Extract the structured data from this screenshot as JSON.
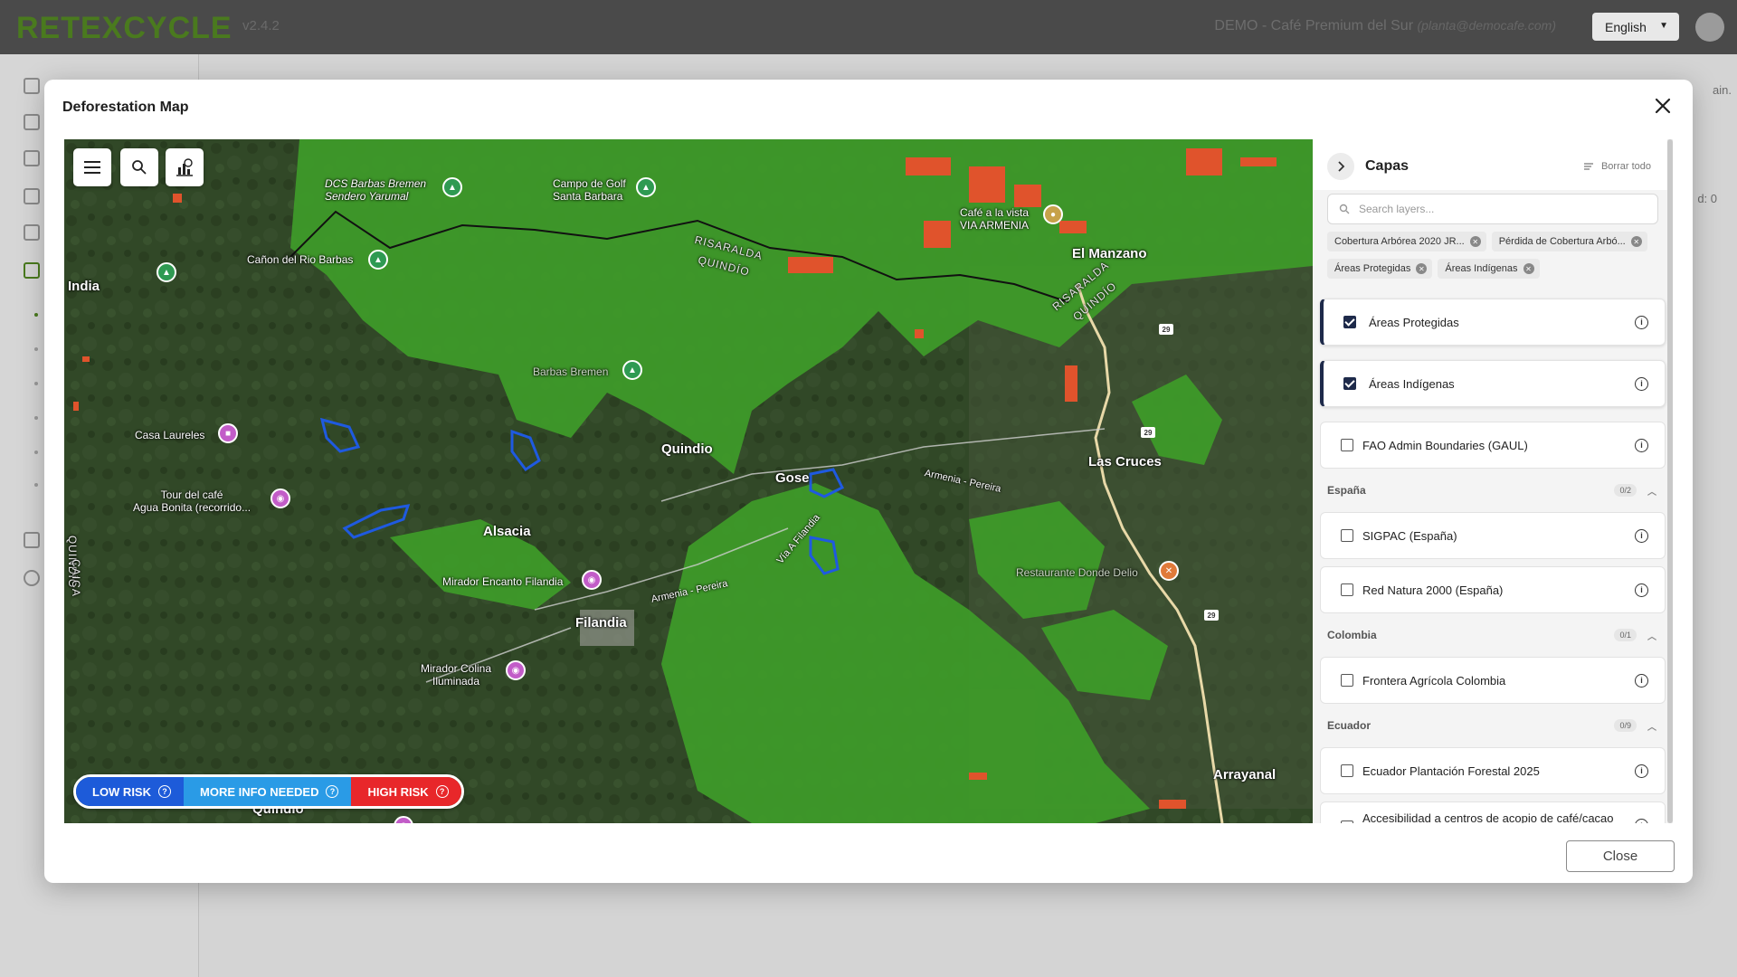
{
  "app": {
    "brand": "RETEXCYCLE",
    "version": "v2.4.2",
    "company": "DEMO - Café Premium del Sur",
    "company_email": "(planta@democafe.com)",
    "language": "English",
    "bg_text_right": "ain.",
    "bg_text_count": "d: 0"
  },
  "modal": {
    "title": "Deforestation Map",
    "close_label": "Close"
  },
  "map": {
    "tool_icons": [
      "menu-icon",
      "search-icon",
      "chart-icon"
    ],
    "place_labels": {
      "india": "India",
      "quindio_center": "Quindio",
      "alsacia": "Alsacia",
      "filandia": "Filandia",
      "gose": "Gose",
      "las_cruces": "Las Cruces",
      "el_manzano": "El Manzano",
      "arrayanal": "Arrayanal",
      "quindio_bottom": "Quindio"
    },
    "poi_labels": {
      "dcs_barbas": "DCS Barbas Bremen\nSendero Yarumal",
      "campo_golf": "Campo de Golf\nSanta Barbara",
      "canon_rio": "Cañon del Rio Barbas",
      "cafe_vista": "Café a la vista\nVIA ARMENIA",
      "barbas_bremen": "Barbas Bremen",
      "casa_laureles": "Casa Laureles",
      "tour_cafe": "Tour del café\nAgua Bonita (recorrido...",
      "mirador_encanto": "Mirador Encanto Filandia",
      "mirador_colina": "Mirador Colina\nIluminada",
      "restaurante": "Restaurante Donde Delio"
    },
    "road_labels": {
      "armenia_pereira_1": "Armenia - Pereira",
      "armenia_pereira_2": "Armenia - Pereira",
      "via_filandia": "Vía A Filandia"
    },
    "region_labels": {
      "risaralda_1": "RISARALDA",
      "quindio_1": "QUINDÍO",
      "risaralda_2": "RISARALDA",
      "quindio_2": "QUINDÍO",
      "quindio_left": "QUINDÍO",
      "caica": "CAICA"
    },
    "road_shields": [
      "29",
      "29",
      "29"
    ],
    "legend": {
      "low": "LOW RISK",
      "info": "MORE INFO NEEDED",
      "high": "HIGH RISK"
    },
    "colors": {
      "tree_cover": "#3f9a2a",
      "loss": "#e0532c",
      "plots": "#1f5ae0",
      "low_risk": "#1d5bd9",
      "more_info": "#2a9be6",
      "high_risk": "#e8272a"
    }
  },
  "layers_panel": {
    "title": "Capas",
    "clear_all": "Borrar todo",
    "search_placeholder": "Search layers...",
    "chips": [
      "Cobertura Arbórea 2020 JR...",
      "Pérdida de Cobertura Arbó...",
      "Áreas Protegidas",
      "Áreas Indígenas"
    ],
    "top_layers": [
      {
        "name": "Áreas Protegidas",
        "checked": true
      },
      {
        "name": "Áreas Indígenas",
        "checked": true
      },
      {
        "name": "FAO Admin Boundaries (GAUL)",
        "checked": false
      }
    ],
    "groups": [
      {
        "name": "España",
        "count": "0/2",
        "layers": [
          "SIGPAC (España)",
          "Red Natura 2000 (España)"
        ]
      },
      {
        "name": "Colombia",
        "count": "0/1",
        "layers": [
          "Frontera Agrícola Colombia"
        ]
      },
      {
        "name": "Ecuador",
        "count": "0/9",
        "layers": [
          "Ecuador Plantación Forestal 2025",
          "Accesibilidad a centros de acopio de café/cacao"
        ]
      }
    ]
  }
}
